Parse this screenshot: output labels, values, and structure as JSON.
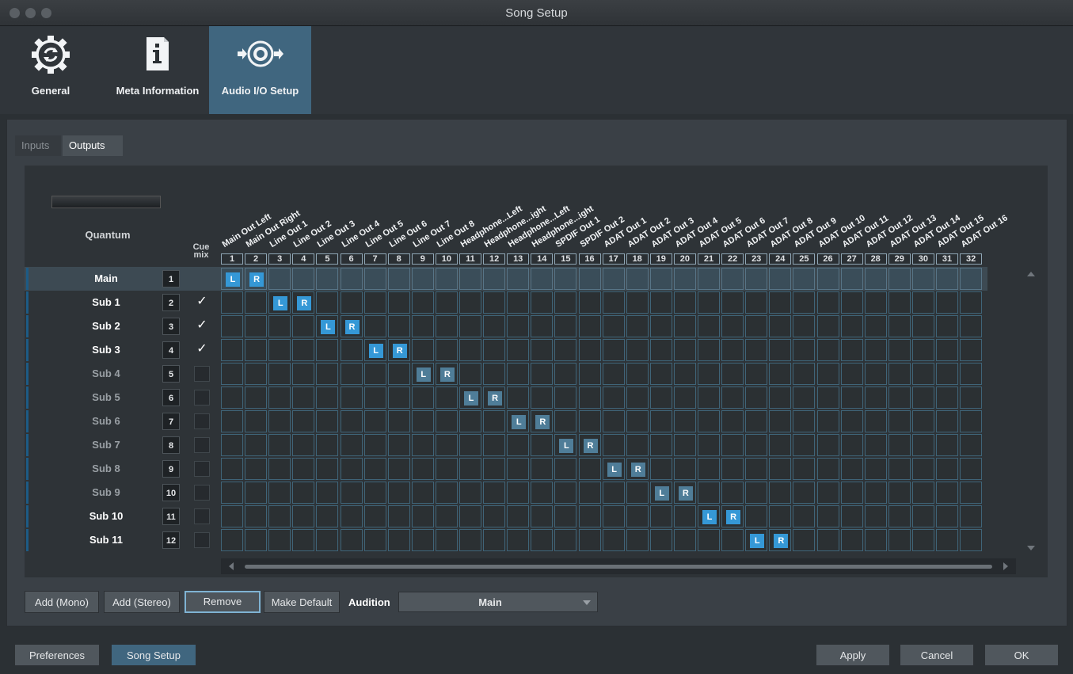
{
  "window": {
    "title": "Song Setup"
  },
  "top_tabs": [
    {
      "label": "General",
      "icon": "gear-refresh-icon"
    },
    {
      "label": "Meta Information",
      "icon": "info-document-icon"
    },
    {
      "label": "Audio I/O Setup",
      "icon": "speaker-io-icon",
      "active": true
    }
  ],
  "sub_tabs": [
    {
      "label": "Inputs",
      "active": false
    },
    {
      "label": "Outputs",
      "active": true
    }
  ],
  "device": {
    "name": "Quantum",
    "image": "interface-device-image"
  },
  "cue_header": {
    "line1": "Cue",
    "line2": "mix"
  },
  "outputs": [
    {
      "num": "1",
      "name": "Main Out Left"
    },
    {
      "num": "2",
      "name": "Main Out Right"
    },
    {
      "num": "3",
      "name": "Line Out 1"
    },
    {
      "num": "4",
      "name": "Line Out 2"
    },
    {
      "num": "5",
      "name": "Line Out 3"
    },
    {
      "num": "6",
      "name": "Line Out 4"
    },
    {
      "num": "7",
      "name": "Line Out 5"
    },
    {
      "num": "8",
      "name": "Line Out 6"
    },
    {
      "num": "9",
      "name": "Line Out 7"
    },
    {
      "num": "10",
      "name": "Line Out 8"
    },
    {
      "num": "11",
      "name": "Headphone...Left"
    },
    {
      "num": "12",
      "name": "Headphone...ight"
    },
    {
      "num": "13",
      "name": "Headphone...Left"
    },
    {
      "num": "14",
      "name": "Headphone...ight"
    },
    {
      "num": "15",
      "name": "SPDIF Out 1"
    },
    {
      "num": "16",
      "name": "SPDIF Out 2"
    },
    {
      "num": "17",
      "name": "ADAT Out 1"
    },
    {
      "num": "18",
      "name": "ADAT Out 2"
    },
    {
      "num": "19",
      "name": "ADAT Out 3"
    },
    {
      "num": "20",
      "name": "ADAT Out 4"
    },
    {
      "num": "21",
      "name": "ADAT Out 5"
    },
    {
      "num": "22",
      "name": "ADAT Out 6"
    },
    {
      "num": "23",
      "name": "ADAT Out 7"
    },
    {
      "num": "24",
      "name": "ADAT Out 8"
    },
    {
      "num": "25",
      "name": "ADAT Out 9"
    },
    {
      "num": "26",
      "name": "ADAT Out 10"
    },
    {
      "num": "27",
      "name": "ADAT Out 11"
    },
    {
      "num": "28",
      "name": "ADAT Out 12"
    },
    {
      "num": "29",
      "name": "ADAT Out 13"
    },
    {
      "num": "30",
      "name": "ADAT Out 14"
    },
    {
      "num": "31",
      "name": "ADAT Out 15"
    },
    {
      "num": "32",
      "name": "ADAT Out 16"
    }
  ],
  "buses": [
    {
      "name": "Main",
      "num": "1",
      "cue": null,
      "active": true,
      "left_out": 1,
      "right_out": 2
    },
    {
      "name": "Sub 1",
      "num": "2",
      "cue": true,
      "active": true,
      "left_out": 3,
      "right_out": 4
    },
    {
      "name": "Sub 2",
      "num": "3",
      "cue": true,
      "active": true,
      "left_out": 5,
      "right_out": 6
    },
    {
      "name": "Sub 3",
      "num": "4",
      "cue": true,
      "active": true,
      "left_out": 7,
      "right_out": 8
    },
    {
      "name": "Sub 4",
      "num": "5",
      "cue": false,
      "active": false,
      "left_out": 9,
      "right_out": 10
    },
    {
      "name": "Sub 5",
      "num": "6",
      "cue": false,
      "active": false,
      "left_out": 11,
      "right_out": 12
    },
    {
      "name": "Sub 6",
      "num": "7",
      "cue": false,
      "active": false,
      "left_out": 13,
      "right_out": 14
    },
    {
      "name": "Sub 7",
      "num": "8",
      "cue": false,
      "active": false,
      "left_out": 15,
      "right_out": 16
    },
    {
      "name": "Sub 8",
      "num": "9",
      "cue": false,
      "active": false,
      "left_out": 17,
      "right_out": 18
    },
    {
      "name": "Sub 9",
      "num": "10",
      "cue": false,
      "active": false,
      "left_out": 19,
      "right_out": 20
    },
    {
      "name": "Sub 10",
      "num": "11",
      "cue": false,
      "active": true,
      "left_out": 21,
      "right_out": 22
    },
    {
      "name": "Sub 11",
      "num": "12",
      "cue": false,
      "active": true,
      "left_out": 23,
      "right_out": 24
    }
  ],
  "channel_labels": {
    "left": "L",
    "right": "R"
  },
  "cue_check_glyph": "✓",
  "buttons": {
    "add_mono": "Add (Mono)",
    "add_stereo": "Add (Stereo)",
    "remove": "Remove",
    "make_default": "Make Default"
  },
  "audition": {
    "label": "Audition",
    "value": "Main"
  },
  "footer": {
    "preferences": "Preferences",
    "song_setup": "Song Setup",
    "apply": "Apply",
    "cancel": "Cancel",
    "ok": "OK"
  },
  "colors": {
    "accent": "#40667f",
    "chip_blue": "#3598d6",
    "chip_dim": "#4f7d98",
    "grid_border": "#3f6478"
  }
}
